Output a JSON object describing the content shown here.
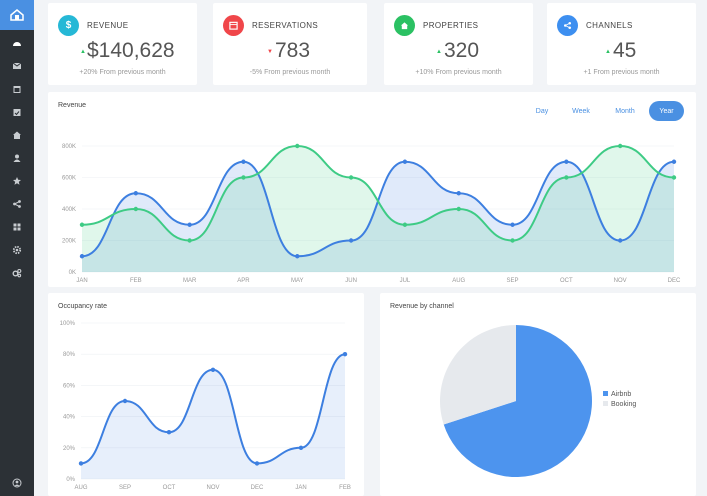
{
  "sidebar": {
    "logo": "home-logo-icon",
    "items": [
      "dashboard-icon",
      "mail-icon",
      "calendar-icon",
      "calendar-check-icon",
      "home-icon",
      "user-icon",
      "star-icon",
      "share-icon",
      "grid-icon",
      "gear-icon",
      "gears-icon"
    ],
    "footer": "user-circle-icon"
  },
  "stats": [
    {
      "label": "REVENUE",
      "value": "$140,628",
      "change": "+20% From previous month",
      "trend": "up",
      "icon": "dollar-icon",
      "color": "#26b8d6"
    },
    {
      "label": "RESERVATIONS",
      "value": "783",
      "change": "-5% From previous month",
      "trend": "down",
      "icon": "calendar-icon",
      "color": "#f0464a"
    },
    {
      "label": "PROPERTIES",
      "value": "320",
      "change": "+10% From previous month",
      "trend": "up",
      "icon": "home-icon",
      "color": "#2bc163"
    },
    {
      "label": "CHANNELS",
      "value": "45",
      "change": "+1 From previous month",
      "trend": "up",
      "icon": "share-icon",
      "color": "#3d8ff0"
    }
  ],
  "revenue_panel": {
    "title": "Revenue",
    "tabs": [
      "Day",
      "Week",
      "Month",
      "Year"
    ],
    "active_tab": "Year"
  },
  "occupancy_panel": {
    "title": "Occupancy rate"
  },
  "channel_panel": {
    "title": "Revenue by channel"
  },
  "chart_data": [
    {
      "type": "area",
      "x": [
        "JAN",
        "FEB",
        "MAR",
        "APR",
        "MAY",
        "JUN",
        "JUL",
        "AUG",
        "SEP",
        "OCT",
        "NOV",
        "DEC"
      ],
      "y_ticks": [
        "0K",
        "200K",
        "400K",
        "600K",
        "800K"
      ],
      "ylim": [
        0,
        800
      ],
      "series": [
        {
          "values": [
            100,
            500,
            300,
            700,
            100,
            200,
            700,
            500,
            300,
            700,
            200,
            700
          ],
          "color": "#3d7fe0"
        },
        {
          "values": [
            300,
            400,
            200,
            600,
            800,
            600,
            300,
            400,
            200,
            600,
            800,
            600
          ],
          "color": "#3ecb85"
        }
      ],
      "grid": true
    },
    {
      "type": "line",
      "x": [
        "AUG",
        "SEP",
        "OCT",
        "NOV",
        "DEC",
        "JAN",
        "FEB"
      ],
      "y_ticks": [
        "0%",
        "20%",
        "40%",
        "60%",
        "80%",
        "100%"
      ],
      "ylim": [
        0,
        100
      ],
      "series": [
        {
          "values": [
            10,
            50,
            30,
            70,
            10,
            20,
            80
          ],
          "color": "#3d7fe0"
        }
      ],
      "grid": true
    },
    {
      "type": "pie",
      "labels": [
        "Airbnb",
        "Booking"
      ],
      "values": [
        70,
        30
      ],
      "colors": [
        "#4d94ee",
        "#e6e9ed"
      ],
      "legend": "right"
    }
  ]
}
